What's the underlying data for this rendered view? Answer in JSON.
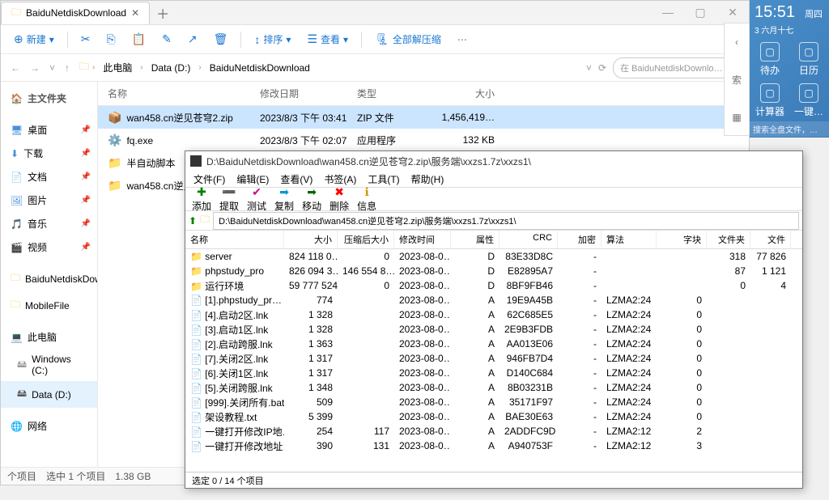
{
  "mainWindow": {
    "tabTitle": "BaiduNetdiskDownload",
    "toolbar": {
      "new": "新建",
      "sort": "排序",
      "view": "查看",
      "extractAll": "全部解压缩"
    },
    "breadcrumb": {
      "item1": "此电脑",
      "item2": "Data (D:)",
      "item3": "BaiduNetdiskDownload"
    },
    "searchPlaceholder": "在 BaiduNetdiskDownlo…",
    "sidebar": {
      "home": "主文件夹",
      "desktop": "桌面",
      "downloads": "下载",
      "documents": "文档",
      "pictures": "图片",
      "music": "音乐",
      "videos": "视频",
      "folder1": "BaiduNetdiskDow",
      "folder2": "MobileFile",
      "thispc": "此电脑",
      "driveC": "Windows (C:)",
      "driveD": "Data (D:)",
      "network": "网络"
    },
    "columns": {
      "name": "名称",
      "date": "修改日期",
      "type": "类型",
      "size": "大小"
    },
    "files": [
      {
        "name": "wan458.cn逆见苍穹2.zip",
        "date": "2023/8/3 下午 03:41",
        "type": "ZIP 文件",
        "size": "1,456,419…",
        "icon": "📦",
        "selected": true
      },
      {
        "name": "fq.exe",
        "date": "2023/8/3 下午 02:07",
        "type": "应用程序",
        "size": "132 KB",
        "icon": "⚙️"
      },
      {
        "name": "半自动脚本",
        "date": "",
        "type": "",
        "size": "",
        "icon": "📁"
      },
      {
        "name": "wan458.cn逆见苍",
        "date": "",
        "type": "",
        "size": "",
        "icon": "📁"
      }
    ],
    "status": {
      "items": "个项目",
      "selected": "选中 1 个项目",
      "selSize": "1.38 GB"
    }
  },
  "zipWindow": {
    "title": "D:\\BaiduNetdiskDownload\\wan458.cn逆见苍穹2.zip\\服务端\\xxzs1.7z\\xxzs1\\",
    "menus": [
      "文件(F)",
      "编辑(E)",
      "查看(V)",
      "书签(A)",
      "工具(T)",
      "帮助(H)"
    ],
    "toolbarLabels": {
      "add": "添加",
      "extract": "提取",
      "test": "测试",
      "copy": "复制",
      "move": "移动",
      "delete": "删除",
      "info": "信息"
    },
    "path": "D:\\BaiduNetdiskDownload\\wan458.cn逆见苍穹2.zip\\服务端\\xxzs1.7z\\xxzs1\\",
    "columns": {
      "name": "名称",
      "size": "大小",
      "csize": "压缩后大小",
      "mtime": "修改时间",
      "attr": "属性",
      "crc": "CRC",
      "enc": "加密",
      "algo": "算法",
      "block": "字块",
      "folders": "文件夹",
      "files": "文件"
    },
    "rows": [
      {
        "name": "server",
        "icon": "📁",
        "size": "824 118 0…",
        "csize": "0",
        "mtime": "2023-08-0…",
        "attr": "D",
        "crc": "83E33D8C",
        "enc": "-",
        "algo": "",
        "block": "",
        "folders": "318",
        "files": "77 826"
      },
      {
        "name": "phpstudy_pro",
        "icon": "📁",
        "size": "826 094 3…",
        "csize": "146 554 8…",
        "mtime": "2023-08-0…",
        "attr": "D",
        "crc": "E82895A7",
        "enc": "-",
        "algo": "",
        "block": "",
        "folders": "87",
        "files": "1 121"
      },
      {
        "name": "运行环境",
        "icon": "📁",
        "size": "59 777 524",
        "csize": "0",
        "mtime": "2023-08-0…",
        "attr": "D",
        "crc": "8BF9FB46",
        "enc": "-",
        "algo": "",
        "block": "",
        "folders": "0",
        "files": "4"
      },
      {
        "name": "[1].phpstudy_pr…",
        "icon": "📄",
        "size": "774",
        "csize": "",
        "mtime": "2023-08-0…",
        "attr": "A",
        "crc": "19E9A45B",
        "enc": "-",
        "algo": "LZMA2:24",
        "block": "0",
        "folders": "",
        "files": ""
      },
      {
        "name": "[4].启动2区.lnk",
        "icon": "📄",
        "size": "1 328",
        "csize": "",
        "mtime": "2023-08-0…",
        "attr": "A",
        "crc": "62C685E5",
        "enc": "-",
        "algo": "LZMA2:24",
        "block": "0",
        "folders": "",
        "files": ""
      },
      {
        "name": "[3].启动1区.lnk",
        "icon": "📄",
        "size": "1 328",
        "csize": "",
        "mtime": "2023-08-0…",
        "attr": "A",
        "crc": "2E9B3FDB",
        "enc": "-",
        "algo": "LZMA2:24",
        "block": "0",
        "folders": "",
        "files": ""
      },
      {
        "name": "[2].启动跨服.lnk",
        "icon": "📄",
        "size": "1 363",
        "csize": "",
        "mtime": "2023-08-0…",
        "attr": "A",
        "crc": "AA013E06",
        "enc": "-",
        "algo": "LZMA2:24",
        "block": "0",
        "folders": "",
        "files": ""
      },
      {
        "name": "[7].关闭2区.lnk",
        "icon": "📄",
        "size": "1 317",
        "csize": "",
        "mtime": "2023-08-0…",
        "attr": "A",
        "crc": "946FB7D4",
        "enc": "-",
        "algo": "LZMA2:24",
        "block": "0",
        "folders": "",
        "files": ""
      },
      {
        "name": "[6].关闭1区.lnk",
        "icon": "📄",
        "size": "1 317",
        "csize": "",
        "mtime": "2023-08-0…",
        "attr": "A",
        "crc": "D140C684",
        "enc": "-",
        "algo": "LZMA2:24",
        "block": "0",
        "folders": "",
        "files": ""
      },
      {
        "name": "[5].关闭跨服.lnk",
        "icon": "📄",
        "size": "1 348",
        "csize": "",
        "mtime": "2023-08-0…",
        "attr": "A",
        "crc": "8B03231B",
        "enc": "-",
        "algo": "LZMA2:24",
        "block": "0",
        "folders": "",
        "files": ""
      },
      {
        "name": "[999].关闭所有.bat",
        "icon": "📄",
        "size": "509",
        "csize": "",
        "mtime": "2023-08-0…",
        "attr": "A",
        "crc": "35171F97",
        "enc": "-",
        "algo": "LZMA2:24",
        "block": "0",
        "folders": "",
        "files": ""
      },
      {
        "name": "架设教程.txt",
        "icon": "📄",
        "size": "5 399",
        "csize": "",
        "mtime": "2023-08-0…",
        "attr": "A",
        "crc": "BAE30E63",
        "enc": "-",
        "algo": "LZMA2:24",
        "block": "0",
        "folders": "",
        "files": ""
      },
      {
        "name": "一键打开修改IP地…",
        "icon": "📄",
        "size": "254",
        "csize": "117",
        "mtime": "2023-08-0…",
        "attr": "A",
        "crc": "2ADDFC9D",
        "enc": "-",
        "algo": "LZMA2:12",
        "block": "2",
        "folders": "",
        "files": ""
      },
      {
        "name": "一键打开修改地址…",
        "icon": "📄",
        "size": "390",
        "csize": "131",
        "mtime": "2023-08-0…",
        "attr": "A",
        "crc": "A940753F",
        "enc": "-",
        "algo": "LZMA2:12",
        "block": "3",
        "folders": "",
        "files": ""
      }
    ],
    "status": "选定 0 / 14 个项目"
  },
  "desktopSide": {
    "time": "15:51",
    "weekday": "周四",
    "date": "3 六月十七",
    "icons": [
      {
        "label": "待办"
      },
      {
        "label": "日历"
      },
      {
        "label": "计算器"
      },
      {
        "label": "一键…"
      }
    ],
    "searchHint": "搜索全盘文件，…",
    "hiddenLabel": "索"
  }
}
